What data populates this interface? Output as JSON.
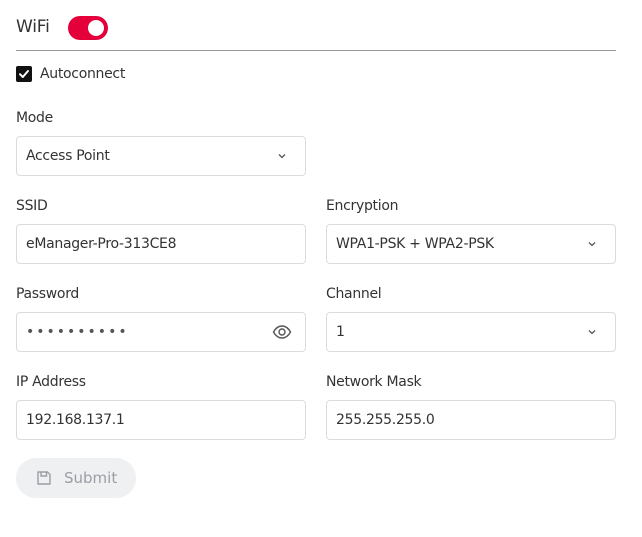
{
  "header": {
    "title": "WiFi",
    "wifi_enabled": true,
    "toggle_icon": "toggle-on-icon",
    "accent_color": "#e4003a"
  },
  "autoconnect": {
    "label": "Autoconnect",
    "checked": true,
    "icon": "checkbox-checked-icon"
  },
  "fields": {
    "mode": {
      "label": "Mode",
      "value": "Access Point",
      "icon": "chevron-down-icon"
    },
    "ssid": {
      "label": "SSID",
      "value": "eManager-Pro-313CE8"
    },
    "encryption": {
      "label": "Encryption",
      "value": "WPA1-PSK + WPA2-PSK",
      "icon": "chevron-down-icon"
    },
    "password": {
      "label": "Password",
      "value": "••••••••••",
      "icon": "eye-icon"
    },
    "channel": {
      "label": "Channel",
      "value": "1",
      "icon": "chevron-down-icon"
    },
    "ip_address": {
      "label": "IP Address",
      "value": "192.168.137.1"
    },
    "network_mask": {
      "label": "Network Mask",
      "value": "255.255.255.0"
    }
  },
  "submit": {
    "label": "Submit",
    "icon": "save-icon",
    "disabled": true
  }
}
